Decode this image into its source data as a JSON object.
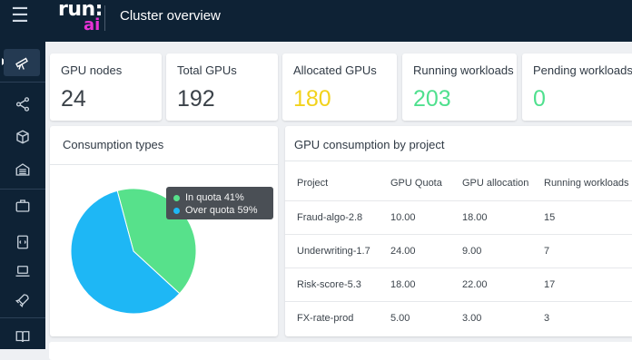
{
  "header": {
    "menu_icon": "hamburger-menu-icon",
    "logo_run": "run:",
    "logo_ai": "ai",
    "title": "Cluster overview"
  },
  "sidebar": {
    "items": [
      {
        "icon": "telescope-icon",
        "active": true
      },
      {
        "icon": "nodes-share-icon"
      },
      {
        "icon": "cube-icon"
      },
      {
        "icon": "datacenter-icon"
      },
      {
        "icon": "briefcase-icon"
      },
      {
        "icon": "notebook-icon"
      },
      {
        "icon": "laptop-icon"
      },
      {
        "icon": "rocket-icon"
      },
      {
        "icon": "book-icon"
      }
    ]
  },
  "stats": [
    {
      "label": "GPU nodes",
      "value": "24",
      "color": "#3b4249"
    },
    {
      "label": "Total GPUs",
      "value": "192",
      "color": "#3b4249"
    },
    {
      "label": "Allocated GPUs",
      "value": "180",
      "color": "#f2d21b"
    },
    {
      "label": "Running workloads",
      "value": "203",
      "color": "#4fe08e"
    },
    {
      "label": "Pending workloads",
      "value": "0",
      "color": "#4fe08e"
    }
  ],
  "consumption": {
    "title": "Consumption types",
    "tooltip": [
      {
        "label": "In quota 41%",
        "color": "#57e18b"
      },
      {
        "label": "Over quota 59%",
        "color": "#1eb7f5"
      }
    ],
    "chart_data": {
      "type": "pie",
      "slices": [
        {
          "label": "In quota",
          "value": 41,
          "color": "#57e18b"
        },
        {
          "label": "Over quota",
          "value": 59,
          "color": "#1eb7f5"
        }
      ]
    }
  },
  "gpu_table": {
    "title": "GPU consumption by project",
    "columns": [
      "Project",
      "GPU Quota",
      "GPU allocation",
      "Running workloads"
    ],
    "rows": [
      [
        "Fraud-algo-2.8",
        "10.00",
        "18.00",
        "15"
      ],
      [
        "Underwriting-1.7",
        "24.00",
        "9.00",
        "7"
      ],
      [
        "Risk-score-5.3",
        "18.00",
        "22.00",
        "17"
      ],
      [
        "FX-rate-prod",
        "5.00",
        "3.00",
        "3"
      ]
    ]
  }
}
